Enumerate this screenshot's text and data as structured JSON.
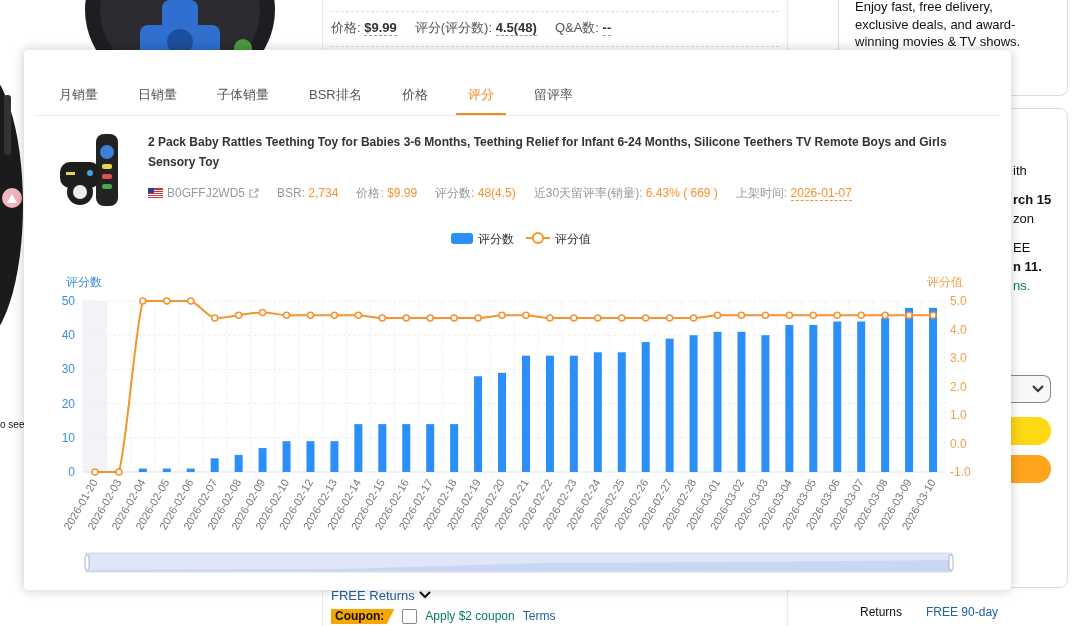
{
  "background_page": {
    "info_row": [
      {
        "label": "价格:",
        "value": "$9.99"
      },
      {
        "label": "评分(评分数):",
        "value": "4.5(48)"
      },
      {
        "label": "Q&A数:",
        "value": "--"
      }
    ],
    "left_note": "o see",
    "membership_text": "Enjoy fast, free delivery, exclusive deals, and award-winning movies & TV shows.",
    "buy_box_fragments": [
      [
        {
          "text": "ith",
          "kind": "plain"
        }
      ],
      [
        {
          "text": "rch 15",
          "kind": "bold"
        },
        {
          "text": "zon",
          "kind": "plain"
        }
      ],
      [
        {
          "text": "EE",
          "kind": "plain"
        },
        {
          "text": "n 11.",
          "kind": "bold"
        },
        {
          "text": "ns.",
          "kind": "link"
        }
      ]
    ],
    "returns_link": "FREE Returns",
    "coupon": {
      "badge": "Coupon:",
      "checked": false,
      "text": "Apply $2 coupon",
      "terms": "Terms"
    },
    "returns_row": {
      "label": "Returns",
      "value": "FREE 90-day"
    }
  },
  "popup": {
    "range_slider": {
      "level": 1
    },
    "tabs": [
      {
        "label": "月销量",
        "selected": false
      },
      {
        "label": "日销量",
        "selected": false
      },
      {
        "label": "子体销量",
        "selected": false
      },
      {
        "label": "BSR排名",
        "selected": false
      },
      {
        "label": "价格",
        "selected": false
      },
      {
        "label": "评分",
        "selected": true
      },
      {
        "label": "留评率",
        "selected": false
      }
    ],
    "product": {
      "title": "2 Pack Baby Rattles Teething Toy for Babies 3-6 Months, Teething Relief for Infant 6-24 Months, Silicone Teethers TV Remote Boys and Girls Sensory Toy",
      "asin": "B0GFFJ2WD5",
      "stats": [
        {
          "label": "BSR:",
          "value": "2,734",
          "underlined": false
        },
        {
          "label": "价格:",
          "value": "$9.99",
          "underlined": false
        },
        {
          "label": "评分数:",
          "value": "48(4.5)",
          "underlined": false
        },
        {
          "label": "近30天留评率(销量):",
          "value": "6.43% ( 669 )",
          "underlined": false
        },
        {
          "label": "上架时间:",
          "value": "2026-01-07",
          "underlined": true
        }
      ]
    },
    "chart_data": {
      "type": "bar",
      "ylabel": "评分数",
      "y2label": "评分值",
      "categories": [
        "2026-01-20",
        "2026-02-03",
        "2026-02-04",
        "2026-02-05",
        "2026-02-06",
        "2026-02-07",
        "2026-02-08",
        "2026-02-09",
        "2026-02-10",
        "2026-02-12",
        "2026-02-13",
        "2026-02-14",
        "2026-02-15",
        "2026-02-16",
        "2026-02-17",
        "2026-02-18",
        "2026-02-19",
        "2026-02-20",
        "2026-02-21",
        "2026-02-22",
        "2026-02-23",
        "2026-02-24",
        "2026-02-25",
        "2026-02-26",
        "2026-02-27",
        "2026-02-28",
        "2026-03-01",
        "2026-03-02",
        "2026-03-03",
        "2026-03-04",
        "2026-03-05",
        "2026-03-06",
        "2026-03-07",
        "2026-03-08",
        "2026-03-09",
        "2026-03-10"
      ],
      "series": [
        {
          "name": "评分数",
          "color": "#2b8ff7",
          "values": [
            0,
            0,
            1,
            1,
            1,
            4,
            5,
            7,
            9,
            9,
            9,
            14,
            14,
            14,
            14,
            14,
            28,
            29,
            34,
            34,
            34,
            35,
            35,
            38,
            39,
            40,
            41,
            41,
            40,
            43,
            43,
            44,
            44,
            45,
            48,
            48
          ]
        },
        {
          "name": "评分值",
          "type": "line",
          "axis": "y2",
          "marker": "circle",
          "color": "#f5932f",
          "values": [
            -1,
            -1,
            5,
            5,
            5,
            4.4,
            4.5,
            4.6,
            4.5,
            4.5,
            4.5,
            4.5,
            4.4,
            4.4,
            4.4,
            4.4,
            4.4,
            4.5,
            4.5,
            4.4,
            4.4,
            4.4,
            4.4,
            4.4,
            4.4,
            4.4,
            4.5,
            4.5,
            4.5,
            4.5,
            4.5,
            4.5,
            4.5,
            4.5,
            4.5,
            4.5
          ]
        }
      ],
      "grid": true,
      "legend": "top",
      "ylim": [
        0,
        50
      ],
      "yticks": [
        0,
        10,
        20,
        30,
        40,
        50
      ],
      "y2lim": [
        -1,
        5
      ],
      "y2ticks": [
        {
          "value": -1,
          "label": "-1.0"
        },
        {
          "value": 0,
          "label": "0.0"
        },
        {
          "value": 1,
          "label": "1.0"
        },
        {
          "value": 2,
          "label": "2.0"
        },
        {
          "value": 3,
          "label": "3.0"
        },
        {
          "value": 4,
          "label": "4.0"
        },
        {
          "value": 5,
          "label": "5.0"
        }
      ]
    }
  }
}
